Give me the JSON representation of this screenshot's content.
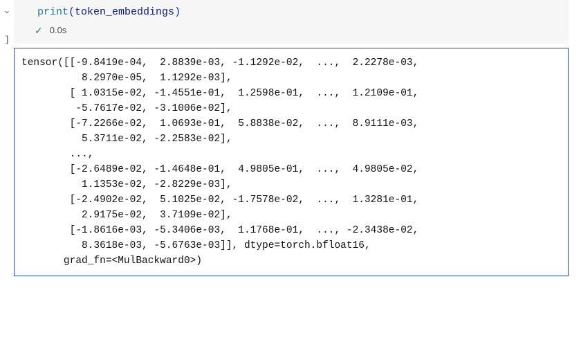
{
  "gutter": {
    "chevron_glyph": "⌄",
    "cell_order": "]"
  },
  "code": {
    "builtin": "print",
    "open_paren": "(",
    "variable": "token_embeddings",
    "close_paren": ")"
  },
  "status": {
    "check_glyph": "✓",
    "time": "0.0s"
  },
  "output_text": "tensor([[-9.8419e-04,  2.8839e-03, -1.1292e-02,  ...,  2.2278e-03,\n          8.2970e-05,  1.1292e-03],\n        [ 1.0315e-02, -1.4551e-01,  1.2598e-01,  ...,  1.2109e-01,\n         -5.7617e-02, -3.1006e-02],\n        [-7.2266e-02,  1.0693e-01,  5.8838e-02,  ...,  8.9111e-03,\n          5.3711e-02, -2.2583e-02],\n        ...,\n        [-2.6489e-02, -1.4648e-01,  4.9805e-01,  ...,  4.9805e-02,\n          1.1353e-02, -2.8229e-03],\n        [-2.4902e-02,  5.1025e-02, -1.7578e-02,  ...,  1.3281e-01,\n          2.9175e-02,  3.7109e-02],\n        [-1.8616e-03, -5.3406e-03,  1.1768e-01,  ..., -2.3438e-02,\n          8.3618e-03, -5.6763e-03]], dtype=torch.bfloat16,\n       grad_fn=<MulBackward0>)"
}
